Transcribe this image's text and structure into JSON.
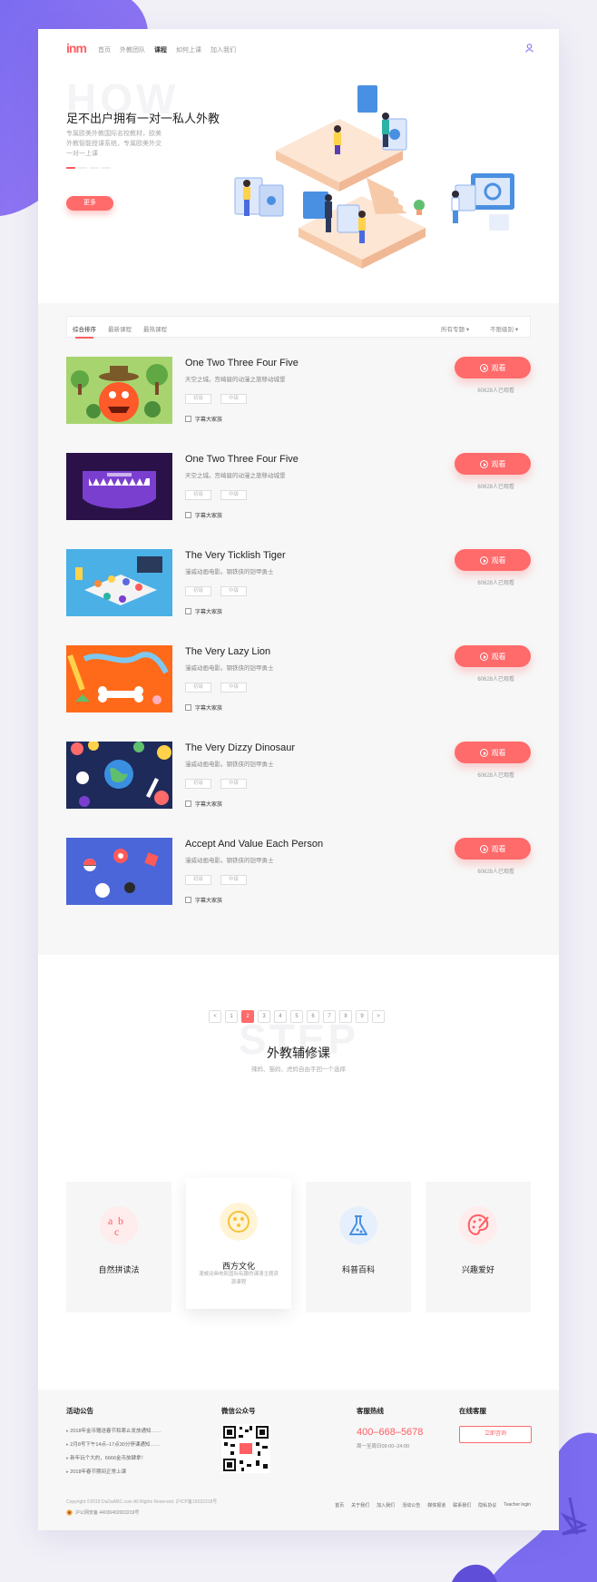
{
  "header": {
    "logo": "inm",
    "nav": [
      "首页",
      "外教团队",
      "课程",
      "如何上课",
      "加入我们"
    ],
    "nav_active": 2
  },
  "hero": {
    "bg_text": "HOW",
    "title": "足不出户拥有一对一私人外教",
    "desc": "专属欧美外教国际名校教材，欧美外教智能授课系统，专属欧美外交一对一上课",
    "more_label": "更多"
  },
  "filter": {
    "tabs": [
      "综合排序",
      "最新课程",
      "最热课程"
    ],
    "active": 0,
    "topic": "所有专题",
    "level": "不限级别"
  },
  "courses": [
    {
      "title": "One Two Three Four Five",
      "sub": "天空之城。宫崎骏的动漫之旅移动城堡",
      "tags": [
        "初级",
        "中级"
      ],
      "check": "字幕大家族",
      "watch": "观看",
      "views": "60628人已观看"
    },
    {
      "title": "One Two Three Four Five",
      "sub": "天空之城。宫崎骏的动漫之旅移动城堡",
      "tags": [
        "初级",
        "中级"
      ],
      "check": "字幕大家族",
      "watch": "观看",
      "views": "60628人已观看"
    },
    {
      "title": "The Very Ticklish Tiger",
      "sub": "漫威动画电影。钢铁侠的铠甲勇士",
      "tags": [
        "初级",
        "中级"
      ],
      "check": "字幕大家族",
      "watch": "观看",
      "views": "60628人已观看"
    },
    {
      "title": "The Very Lazy Lion",
      "sub": "漫威动画电影。钢铁侠的铠甲勇士",
      "tags": [
        "初级",
        "中级"
      ],
      "check": "字幕大家族",
      "watch": "观看",
      "views": "60628人已观看"
    },
    {
      "title": "The Very Dizzy Dinosaur",
      "sub": "漫威动画电影。钢铁侠的铠甲勇士",
      "tags": [
        "初级",
        "中级"
      ],
      "check": "字幕大家族",
      "watch": "观看",
      "views": "60628人已观看"
    },
    {
      "title": "Accept And Value Each Person",
      "sub": "漫威动画电影。钢铁侠的铠甲勇士",
      "tags": [
        "初级",
        "中级"
      ],
      "check": "字幕大家族",
      "watch": "观看",
      "views": "60628人已观看"
    }
  ],
  "pager": [
    "<",
    "1",
    "2",
    "3",
    "4",
    "5",
    "6",
    "7",
    "8",
    "9",
    ">"
  ],
  "pager_active": 2,
  "step": {
    "bg_text": "STEP",
    "title": "外教辅修课",
    "sub": "辣妈、猫妈、虎妈自由手回一个选择",
    "cards": [
      {
        "label": "自然拼读法",
        "desc": "",
        "icon": "abc-icon",
        "color": "#ff6a6a"
      },
      {
        "label": "西方文化",
        "desc": "漫威动画电影国际有趣的课漫主题资源课程",
        "icon": "culture-icon",
        "color": "#f7c23b"
      },
      {
        "label": "科普百科",
        "desc": "",
        "icon": "flask-icon",
        "color": "#4a90e2"
      },
      {
        "label": "兴趣爱好",
        "desc": "",
        "icon": "palette-icon",
        "color": "#ff5e62"
      }
    ]
  },
  "footer": {
    "news_title": "活动公告",
    "news": [
      "2018年金币赠送春节和寒止发放通知……",
      "2月8号下午14点–17点30分停课通知……",
      "新年玩个大的，6666金币放肆拿！",
      "2018年春节期间正常上课"
    ],
    "wechat_title": "微信公众号",
    "hotline_title": "客服热线",
    "phone": "400–668–5678",
    "hours": "周一至周日09:00–24:00",
    "service_title": "在线客服",
    "consult_label": "立即咨询",
    "copyright": "Copyright ©2018 DaDaABC.com All Rights Reserved. 沪ICP备15022318号",
    "beian": "沪公网安备 44030402003219号",
    "links": [
      "首页",
      "关于我们",
      "加入我们",
      "活动公告",
      "媒体报道",
      "联系我们",
      "隐私协议",
      "Teacher login"
    ]
  }
}
